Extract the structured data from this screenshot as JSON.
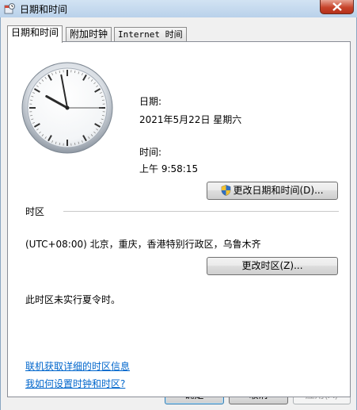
{
  "window": {
    "title": "日期和时间"
  },
  "tabs": [
    {
      "label": "日期和时间"
    },
    {
      "label": "附加时钟"
    },
    {
      "label": "Internet 时间"
    }
  ],
  "date": {
    "label": "日期:",
    "value": "2021年5月22日 星期六"
  },
  "time": {
    "label": "时间:",
    "value": "上午 9:58:15"
  },
  "clock": {
    "hours": 9,
    "minutes": 58,
    "seconds": 15
  },
  "buttons": {
    "change_datetime": "更改日期和时间(D)...",
    "change_timezone": "更改时区(Z)...",
    "ok": "确定",
    "cancel": "取消",
    "apply": "应用(A)"
  },
  "timezone": {
    "section_label": "时区",
    "value": "(UTC+08:00) 北京，重庆，香港特别行政区，乌鲁木齐",
    "dst_note": "此时区未实行夏令时。"
  },
  "links": {
    "online_info": "联机获取详细的时区信息",
    "how_to_set": "我如何设置时钟和时区?"
  },
  "colors": {
    "link": "#0066cc",
    "close": "#c7442b"
  }
}
